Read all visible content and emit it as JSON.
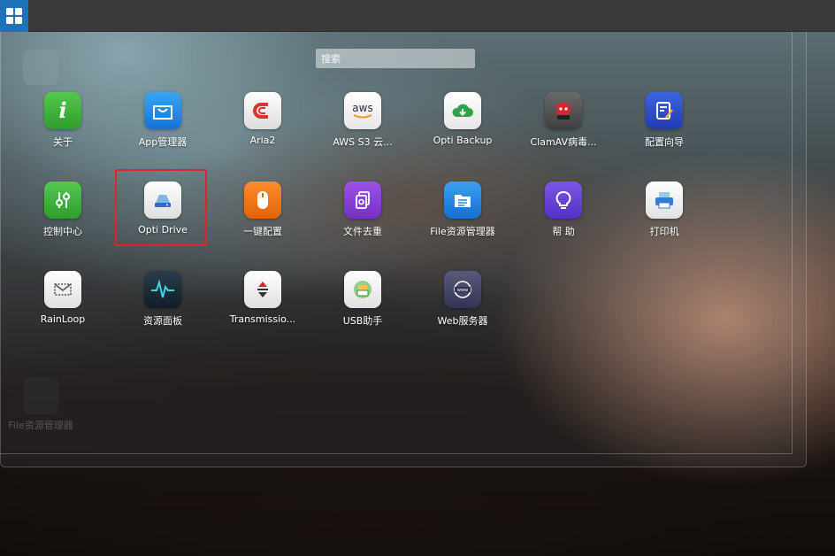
{
  "taskbar": {
    "start_icon": "grid-icon"
  },
  "search": {
    "placeholder": "搜索"
  },
  "apps": [
    {
      "label": "关于",
      "icon": "info-icon",
      "color": "#3db33a"
    },
    {
      "label": "App管理器",
      "icon": "shopping-bag-icon",
      "color": "#1c8fe6"
    },
    {
      "label": "Aria2",
      "icon": "magnet-icon",
      "color": "#f2f2f2"
    },
    {
      "label": "AWS S3 云...",
      "icon": "aws-icon",
      "color": "#f5f5f5"
    },
    {
      "label": "Opti Backup",
      "icon": "cloud-download-icon",
      "color": "#f5f5f5"
    },
    {
      "label": "ClamAV病毒...",
      "icon": "clamav-icon",
      "color": "#555555"
    },
    {
      "label": "配置向导",
      "icon": "wizard-icon",
      "color": "#2d4fcf"
    },
    {
      "label": "控制中心",
      "icon": "sliders-icon",
      "color": "#3db33a"
    },
    {
      "label": "Opti Drive",
      "icon": "drive-icon",
      "color": "#f2f2f2"
    },
    {
      "label": "一键配置",
      "icon": "mouse-icon",
      "color": "#f07a17"
    },
    {
      "label": "文件去重",
      "icon": "file-dedup-icon",
      "color": "#8b3fd6"
    },
    {
      "label": "File资源管理器",
      "icon": "file-manager-icon",
      "color": "#1f8ae0"
    },
    {
      "label": "帮 助",
      "icon": "lightbulb-icon",
      "color": "#6a44d8"
    },
    {
      "label": "打印机",
      "icon": "printer-icon",
      "color": "#f5f5f5"
    },
    {
      "label": "RainLoop",
      "icon": "mail-icon",
      "color": "#f2f2f2"
    },
    {
      "label": "资源面板",
      "icon": "wave-monitor-icon",
      "color": "#1c2b38"
    },
    {
      "label": "Transmissio...",
      "icon": "transmission-icon",
      "color": "#f2f2f2"
    },
    {
      "label": "USB助手",
      "icon": "usb-icon",
      "color": "#f2f2f2"
    },
    {
      "label": "Web服务器",
      "icon": "globe-www-icon",
      "color": "#4a4a6a"
    }
  ],
  "desktop_ghost": {
    "label": "File资源管理器"
  }
}
